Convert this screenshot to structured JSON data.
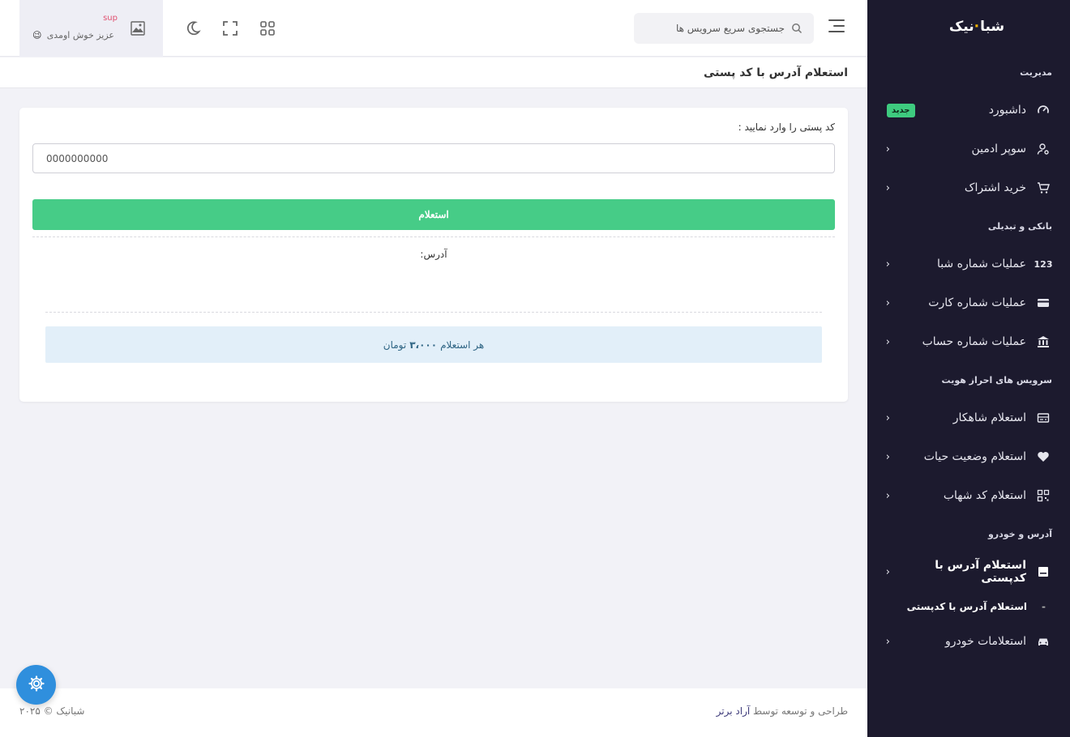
{
  "sidebar": {
    "logo": {
      "part1": "شبا",
      "dot": "·",
      "part2": "نیک"
    },
    "sections": {
      "management": "مدیریت",
      "banking": "بانکی و تبدیلی",
      "identity": "سرویس های احراز هویت",
      "address_car": "آدرس و خودرو"
    },
    "items": {
      "dashboard": {
        "label": "داشبورد",
        "badge": "جدید"
      },
      "super_admin": {
        "label": "سوپر ادمین"
      },
      "subscription": {
        "label": "خرید اشتراک"
      },
      "sheba_ops": {
        "label": "عملیات شماره شبا",
        "icon_text": "123"
      },
      "card_ops": {
        "label": "عملیات شماره کارت"
      },
      "account_ops": {
        "label": "عملیات شماره حساب"
      },
      "shahkar": {
        "label": "استعلام شاهکار"
      },
      "life_status": {
        "label": "استعلام وضعیت حیات"
      },
      "shahab": {
        "label": "استعلام کد شهاب"
      },
      "address_postal": {
        "label": "استعلام آدرس با کدپستی"
      },
      "address_postal_sub": {
        "label": "استعلام آدرس با کدپستی",
        "dash": "-"
      },
      "car": {
        "label": "استعلامات خودرو"
      }
    }
  },
  "topbar": {
    "search_placeholder": "جستجوی سریع سرویس ها",
    "user": {
      "name": "sup",
      "welcome": "عزیز خوش اومدی",
      "emoji": "😉"
    }
  },
  "page": {
    "title": "استعلام آدرس با کد پستی"
  },
  "form": {
    "label": "کد پستی را وارد نمایید :",
    "value": "0000000000",
    "button": "استعلام",
    "address_label": "آدرس:",
    "info_prefix": "هر استعلام",
    "info_price": "۳،۰۰۰",
    "info_suffix": "تومان"
  },
  "footer": {
    "credit_prefix": "طراحی و توسعه توسط",
    "credit_link": "آراد برتر",
    "copyright": "شبانیک © ۲۰۲۵"
  },
  "colors": {
    "sidebar_bg": "#1c1a2e",
    "accent_green": "#46cc87",
    "info_bg": "#e2eff9",
    "fab_blue": "#2f8fdd"
  }
}
